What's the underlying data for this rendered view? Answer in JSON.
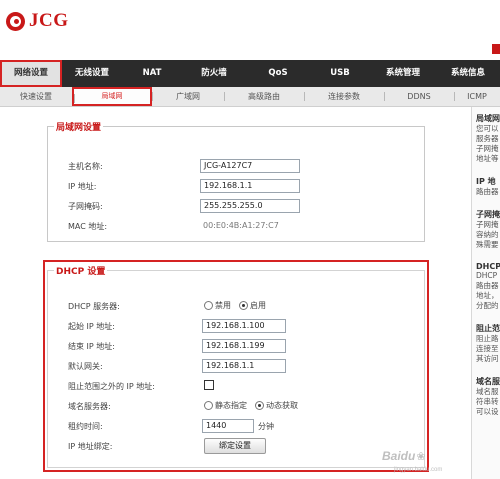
{
  "brand": {
    "name": "JCG"
  },
  "main_nav": [
    {
      "label": "网络设置",
      "active": true
    },
    {
      "label": "无线设置",
      "active": false
    },
    {
      "label": "NAT",
      "active": false
    },
    {
      "label": "防火墙",
      "active": false
    },
    {
      "label": "QoS",
      "active": false
    },
    {
      "label": "USB",
      "active": false
    },
    {
      "label": "系统管理",
      "active": false
    },
    {
      "label": "系统信息",
      "active": false
    }
  ],
  "sub_nav": [
    {
      "label": "快速设置",
      "active": false
    },
    {
      "label": "局域网",
      "active": true
    },
    {
      "label": "广域网",
      "active": false
    },
    {
      "label": "高级路由",
      "active": false
    },
    {
      "label": "连接参数",
      "active": false
    },
    {
      "label": "DDNS",
      "active": false
    },
    {
      "label": "ICMP",
      "active": false
    }
  ],
  "lan": {
    "title": "局域网设置",
    "hostname_label": "主机名称:",
    "hostname_value": "JCG-A127C7",
    "ip_label": "IP 地址:",
    "ip_value": "192.168.1.1",
    "mask_label": "子网掩码:",
    "mask_value": "255.255.255.0",
    "mac_label": "MAC 地址:",
    "mac_value": "00:E0:4B:A1:27:C7"
  },
  "dhcp": {
    "title": "DHCP 设置",
    "server_label": "DHCP 服务器:",
    "server_disable": "禁用",
    "server_enable": "启用",
    "start_label": "起始 IP 地址:",
    "start_value": "192.168.1.100",
    "end_label": "结束 IP 地址:",
    "end_value": "192.168.1.199",
    "gateway_label": "默认网关:",
    "gateway_value": "192.168.1.1",
    "block_label": "阻止范围之外的 IP 地址:",
    "dns_label": "域名服务器:",
    "dns_static": "静态指定",
    "dns_auto": "动态获取",
    "lease_label": "租约时间:",
    "lease_value": "1440",
    "lease_unit": "分钟",
    "bind_label": "IP 地址绑定:",
    "bind_button": "绑定设置"
  },
  "sidebar": {
    "sections": [
      {
        "heading": "局域网",
        "lines": [
          "您可以",
          "服务器",
          "子网掩",
          "地址等"
        ]
      },
      {
        "heading": "IP 地",
        "lines": [
          "路由器"
        ]
      },
      {
        "heading": "子网掩",
        "lines": [
          "子网掩",
          "容纳的",
          "殊需要"
        ]
      },
      {
        "heading": "DHCP",
        "lines": [
          "DHCP",
          "路由器",
          "地址，",
          "分配的"
        ]
      },
      {
        "heading": "阻止范",
        "lines": [
          "阻止路",
          "连接至",
          "其访问"
        ]
      },
      {
        "heading": "域名服",
        "lines": [
          "域名服",
          "符串转",
          "可以设"
        ]
      }
    ]
  },
  "watermark": {
    "logo": "Baidu",
    "sub": "jingyan.baidu.com"
  },
  "colors": {
    "accent_red": "#c81818",
    "nav_bg": "#2b2b2b",
    "highlight_border": "#d52323"
  }
}
